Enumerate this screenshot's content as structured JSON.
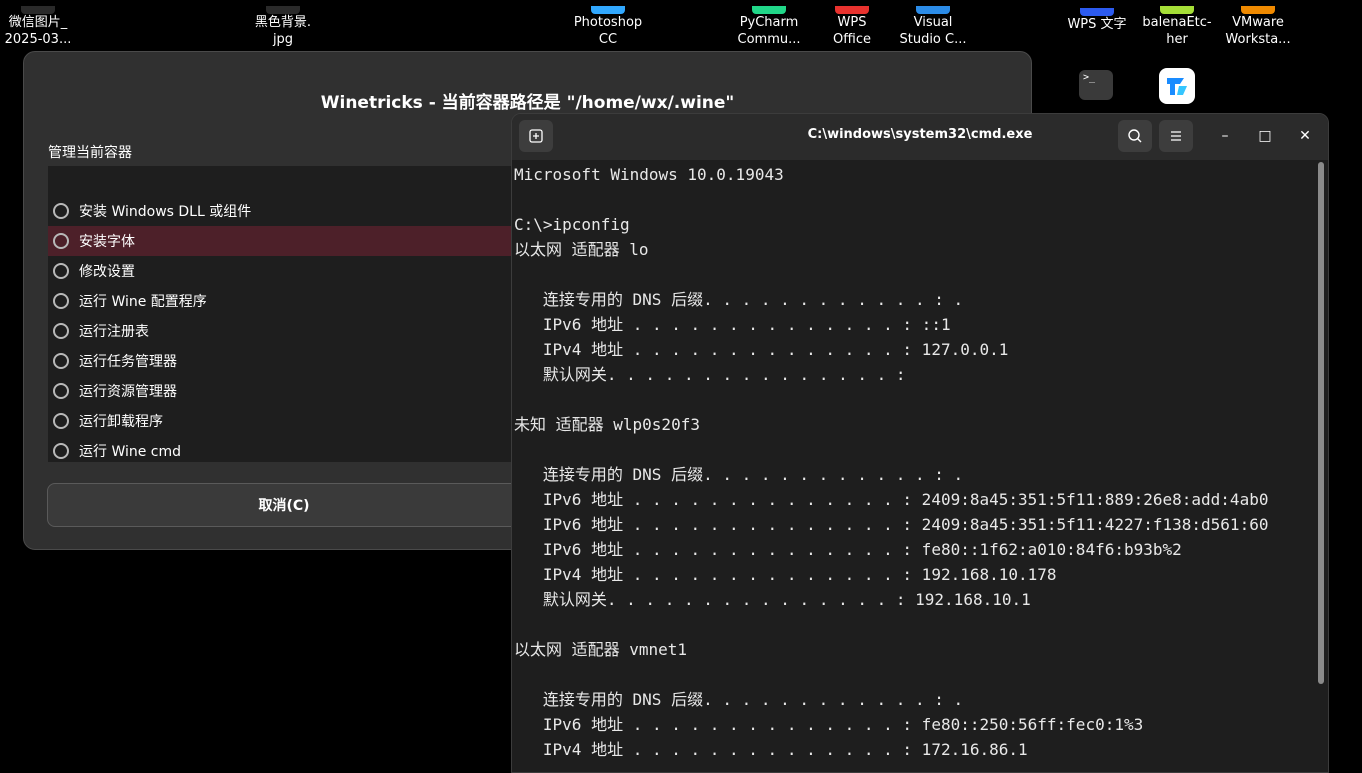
{
  "desktop": {
    "icons": [
      {
        "label": "微信图片_\n2025-03...",
        "color": "#2a2a2a"
      },
      {
        "label": "黑色背景.\njpg",
        "color": "#2a2a2a"
      },
      {
        "label": "Photoshop\nCC",
        "color": "#31a8ff"
      },
      {
        "label": "PyCharm\nCommu...",
        "color": "#21d789"
      },
      {
        "label": "WPS\nOffice",
        "color": "#e8322e"
      },
      {
        "label": "Visual\nStudio C...",
        "color": "#2b8ce8"
      },
      {
        "label": "WPS 文字",
        "color": "#2c5bf0"
      },
      {
        "label": "balenaEtc-\nher",
        "color": "#a5de37"
      },
      {
        "label": "VMware\nWorksta...",
        "color": "#f08a00"
      }
    ]
  },
  "winetricks": {
    "title": "Winetricks - 当前容器路径是 \"/home/wx/.wine\"",
    "section_label": "管理当前容器",
    "options": [
      {
        "label": "安装 Windows DLL 或组件",
        "selected": false
      },
      {
        "label": "安装字体",
        "selected": true
      },
      {
        "label": "修改设置",
        "selected": false
      },
      {
        "label": "运行 Wine 配置程序",
        "selected": false
      },
      {
        "label": "运行注册表",
        "selected": false
      },
      {
        "label": "运行任务管理器",
        "selected": false
      },
      {
        "label": "运行资源管理器",
        "selected": false
      },
      {
        "label": "运行卸载程序",
        "selected": false
      },
      {
        "label": "运行 Wine cmd",
        "selected": false
      }
    ],
    "cancel_label": "取消(C)"
  },
  "terminal": {
    "title": "C:\\windows\\system32\\cmd.exe",
    "new_tab_icon": "new-tab-icon",
    "search_icon": "search-icon",
    "menu_icon": "hamburger-menu-icon",
    "minimize_glyph": "–",
    "maximize_glyph": "□",
    "close_glyph": "✕",
    "lines": [
      "Microsoft Windows 10.0.19043",
      "",
      "C:\\>ipconfig",
      "以太网 适配器 lo",
      "",
      "   连接专用的 DNS 后缀. . . . . . . . . . . . : .",
      "   IPv6 地址 . . . . . . . . . . . . . . : ::1",
      "   IPv4 地址 . . . . . . . . . . . . . . : 127.0.0.1",
      "   默认网关. . . . . . . . . . . . . . . :",
      "",
      "未知 适配器 wlp0s20f3",
      "",
      "   连接专用的 DNS 后缀. . . . . . . . . . . . : .",
      "   IPv6 地址 . . . . . . . . . . . . . . : 2409:8a45:351:5f11:889:26e8:add:4ab0",
      "   IPv6 地址 . . . . . . . . . . . . . . : 2409:8a45:351:5f11:4227:f138:d561:60",
      "   IPv6 地址 . . . . . . . . . . . . . . : fe80::1f62:a010:84f6:b93b%2",
      "   IPv4 地址 . . . . . . . . . . . . . . : 192.168.10.178",
      "   默认网关. . . . . . . . . . . . . . . : 192.168.10.1",
      "",
      "以太网 适配器 vmnet1",
      "",
      "   连接专用的 DNS 后缀. . . . . . . . . . . . : .",
      "   IPv6 地址 . . . . . . . . . . . . . . : fe80::250:56ff:fec0:1%3",
      "   IPv4 地址 . . . . . . . . . . . . . . : 172.16.86.1"
    ]
  }
}
